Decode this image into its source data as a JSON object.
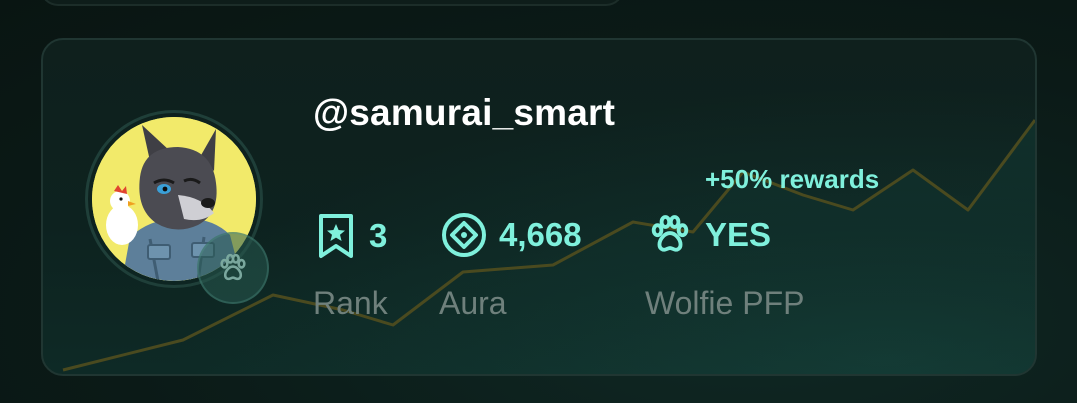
{
  "profile": {
    "username": "@samurai_smart",
    "rewards_badge": "+50% rewards"
  },
  "stats": {
    "rank": {
      "value": "3",
      "label": "Rank",
      "icon": "bookmark-star-icon"
    },
    "aura": {
      "value": "4,668",
      "label": "Aura",
      "icon": "diamond-circle-icon"
    },
    "wolfie": {
      "value": "YES",
      "label": "Wolfie PFP",
      "icon": "paw-icon"
    }
  },
  "colors": {
    "accent": "#7ff0dc",
    "label": "#6f807c",
    "username": "#ffffff",
    "card_bg": "#0f201d",
    "chart_line": "#4a4a1f"
  }
}
